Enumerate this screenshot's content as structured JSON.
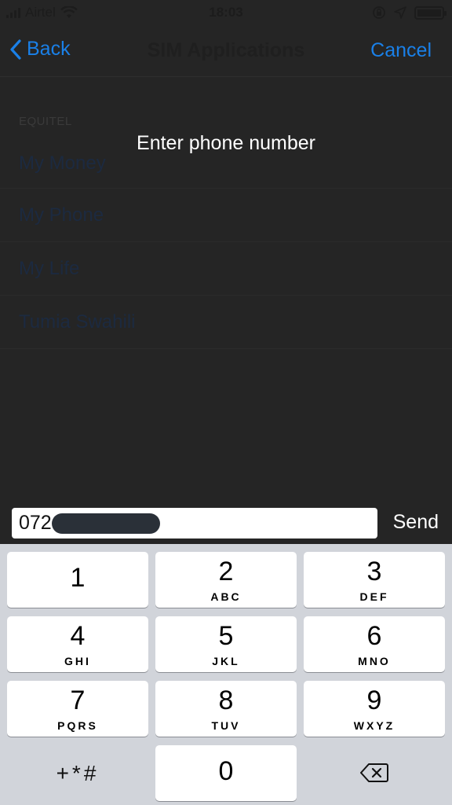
{
  "status_bar": {
    "carrier": "Airtel",
    "time": "18:03"
  },
  "nav": {
    "back_label": "Back",
    "title": "SIM Applications",
    "cancel_label": "Cancel"
  },
  "list": {
    "section_header": "EQUITEL",
    "items": [
      "My Money",
      "My Phone",
      "My Life",
      "Tumia Swahili"
    ]
  },
  "dialog": {
    "prompt": "Enter phone number",
    "input_value": "072",
    "send_label": "Send"
  },
  "keypad": {
    "keys": [
      {
        "digit": "1",
        "letters": ""
      },
      {
        "digit": "2",
        "letters": "ABC"
      },
      {
        "digit": "3",
        "letters": "DEF"
      },
      {
        "digit": "4",
        "letters": "GHI"
      },
      {
        "digit": "5",
        "letters": "JKL"
      },
      {
        "digit": "6",
        "letters": "MNO"
      },
      {
        "digit": "7",
        "letters": "PQRS"
      },
      {
        "digit": "8",
        "letters": "TUV"
      },
      {
        "digit": "9",
        "letters": "WXYZ"
      }
    ],
    "symbols_label": "+*#",
    "zero": "0"
  },
  "colors": {
    "accent": "#1a80e8",
    "background": "#252525",
    "keypad_bg": "#d1d4da"
  }
}
